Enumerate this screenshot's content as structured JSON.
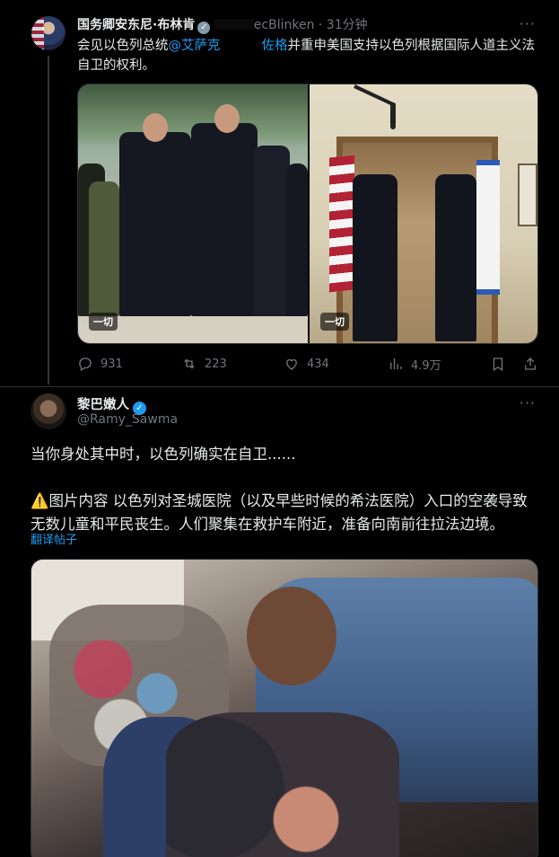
{
  "tweet1": {
    "author_name": "国务卿安东尼·布林肯",
    "handle_partial": "ecBlinken",
    "time": "· 31分钟",
    "more": "···",
    "text_before": "会见以色列总统",
    "mention_start": "@艾萨克",
    "mention_end": "佐格",
    "text_after": "并重申美国支持以色列根据国际人道主义法自卫的权利。",
    "media_badges": [
      "一切",
      "一切"
    ],
    "stats": {
      "replies": "931",
      "reposts": "223",
      "likes": "434",
      "views": "4.9万"
    }
  },
  "tweet2": {
    "author_name": "黎巴嫩人",
    "handle": "@Ramy_Sawma",
    "more": "···",
    "paragraph1": "当你身处其中时，以色列确实在自卫......",
    "paragraph2": "⚠️图片内容 以色列对圣城医院（以及早些时候的希法医院）入口的空袭导致无数儿童和平民丧生。人们聚集在救护车附近，准备向南前往拉法边境。",
    "translate_label": "翻译帖子"
  },
  "colors": {
    "accent": "#1d9bf0",
    "muted": "#71767b",
    "background": "#000000",
    "text": "#e7e9ea"
  }
}
